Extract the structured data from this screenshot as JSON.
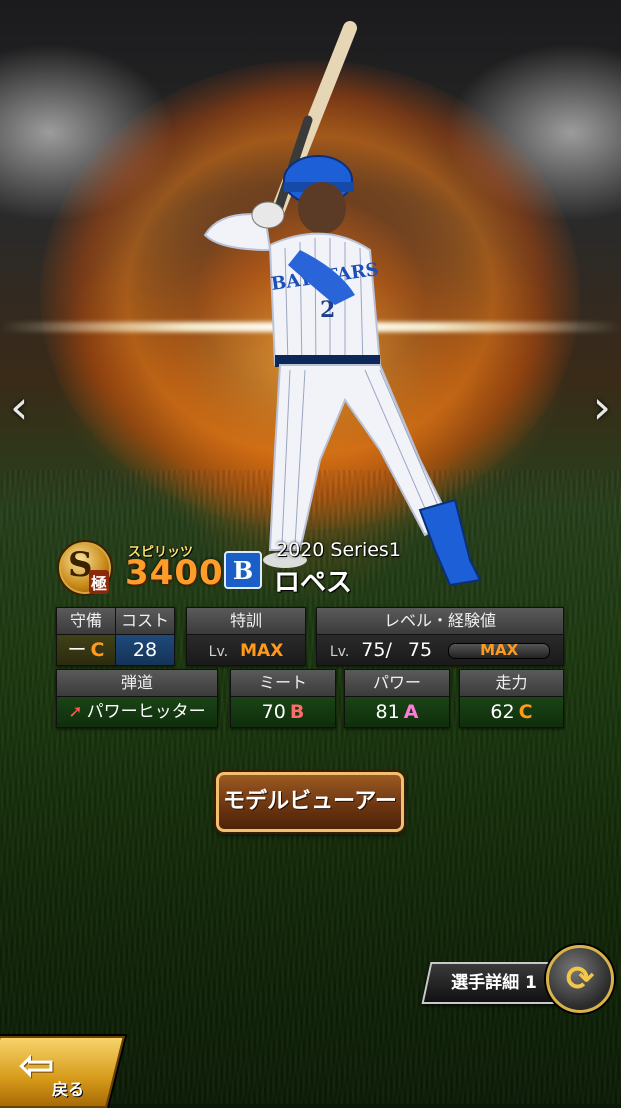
{
  "nav": {
    "prev_glyph": "‹",
    "next_glyph": "›"
  },
  "player": {
    "rank_letter": "S",
    "rank_kanji": "極",
    "spirits_label": "スピリッツ",
    "spirits_value": "3400",
    "team_logo_letter": "B",
    "series": "2020 Series1",
    "name": "ロペス",
    "jersey_number": "2",
    "jersey_text": "BAYSTARS"
  },
  "stats": {
    "defense": {
      "label": "守備",
      "value": "ー",
      "grade": "C"
    },
    "cost": {
      "label": "コスト",
      "value": "28"
    },
    "special_training": {
      "label": "特訓",
      "lv_prefix": "Lv.",
      "value": "MAX"
    },
    "level_exp": {
      "label": "レベル・経験値",
      "lv_prefix": "Lv.",
      "current": "75",
      "separator": "/",
      "max": "75",
      "bar_label": "MAX"
    },
    "trajectory": {
      "label": "弾道",
      "arrow": "➚",
      "value": "パワーヒッター"
    },
    "meet": {
      "label": "ミート",
      "value": "70",
      "grade": "B"
    },
    "power": {
      "label": "パワー",
      "value": "81",
      "grade": "A"
    },
    "speed": {
      "label": "走力",
      "value": "62",
      "grade": "C"
    }
  },
  "buttons": {
    "model_viewer": "モデルビューアー",
    "player_detail": "選手詳細 1",
    "swap_glyph": "⟳",
    "back": "戻る",
    "back_glyph": "⇦"
  },
  "colors": {
    "grade_c": "#ff9a1a",
    "grade_b": "#ff6a6a",
    "grade_a": "#ff7ad9",
    "spirits": "#ff9d2b",
    "team_blue": "#1a5fc8"
  }
}
